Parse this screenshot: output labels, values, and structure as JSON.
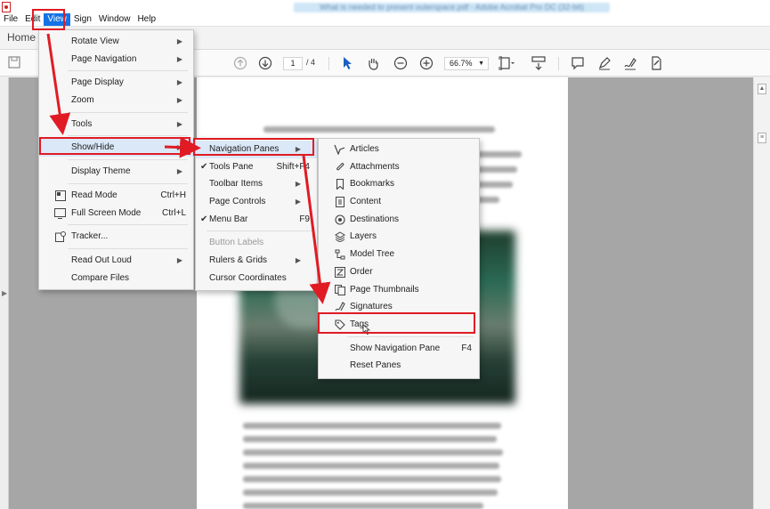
{
  "window": {
    "title": "What is needed to present outerspace.pdf - Adobe Acrobat Pro DC (32-bit)"
  },
  "menubar": [
    "File",
    "Edit",
    "View",
    "Sign",
    "Window",
    "Help"
  ],
  "tabs": {
    "home": "Home"
  },
  "toolbar": {
    "page_current": "1",
    "page_total": "/ 4",
    "zoom": "66.7%"
  },
  "view_menu": {
    "rotate_view": "Rotate View",
    "page_navigation": "Page Navigation",
    "page_display": "Page Display",
    "zoom": "Zoom",
    "tools": "Tools",
    "show_hide": "Show/Hide",
    "display_theme": "Display Theme",
    "read_mode": "Read Mode",
    "read_mode_shortcut": "Ctrl+H",
    "full_screen_mode": "Full Screen Mode",
    "full_screen_shortcut": "Ctrl+L",
    "tracker": "Tracker...",
    "read_out_loud": "Read Out Loud",
    "compare_files": "Compare Files"
  },
  "showhide_menu": {
    "navigation_panes": "Navigation Panes",
    "tools_pane": "Tools Pane",
    "tools_pane_shortcut": "Shift+F4",
    "toolbar_items": "Toolbar Items",
    "page_controls": "Page Controls",
    "menu_bar": "Menu Bar",
    "menu_bar_shortcut": "F9",
    "button_labels": "Button Labels",
    "rulers_grids": "Rulers & Grids",
    "cursor_coordinates": "Cursor Coordinates"
  },
  "navpanes_menu": {
    "articles": "Articles",
    "attachments": "Attachments",
    "bookmarks": "Bookmarks",
    "content": "Content",
    "destinations": "Destinations",
    "layers": "Layers",
    "model_tree": "Model Tree",
    "order": "Order",
    "page_thumbnails": "Page Thumbnails",
    "signatures": "Signatures",
    "tags": "Tags",
    "show_navigation_pane": "Show Navigation Pane",
    "show_navigation_pane_shortcut": "F4",
    "reset_panes": "Reset Panes"
  },
  "colors": {
    "annotation_red": "#e01b24",
    "menu_highlight": "#1473e6"
  }
}
